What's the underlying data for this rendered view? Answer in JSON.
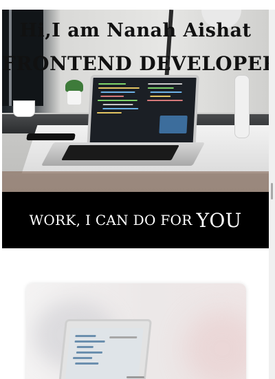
{
  "hero": {
    "greeting_hi": "Hi,",
    "greeting_name": "I am Nanah Aishat",
    "role": "FRONTEND DEVELOPER"
  },
  "band": {
    "text": "WORK, I CAN DO FOR",
    "emphasis": "YOU"
  },
  "colors": {
    "band_background": "#000000",
    "band_text": "#ffffff",
    "hero_text": "#111111"
  },
  "icons": {
    "hero_image": "laptop-desk-image",
    "card_image": "laptop-card-image"
  }
}
